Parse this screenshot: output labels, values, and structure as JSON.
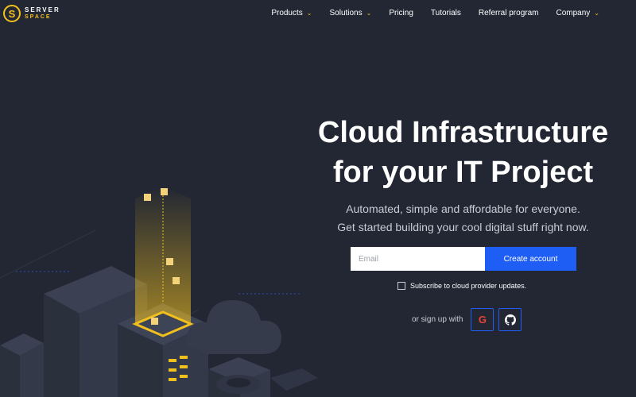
{
  "brand": {
    "word1": "SERVER",
    "word2": "SPACE",
    "mark": "S",
    "accent": "#f2c01e"
  },
  "nav": {
    "items": [
      {
        "label": "Products",
        "dropdown": true
      },
      {
        "label": "Solutions",
        "dropdown": true
      },
      {
        "label": "Pricing",
        "dropdown": false
      },
      {
        "label": "Tutorials",
        "dropdown": false
      },
      {
        "label": "Referral program",
        "dropdown": false
      },
      {
        "label": "Company",
        "dropdown": true
      }
    ]
  },
  "hero": {
    "title_line1": "Cloud Infrastructure",
    "title_line2": "for your IT Project",
    "subtitle_line1": "Automated, simple and affordable for everyone.",
    "subtitle_line2": "Get started building your cool digital stuff right now."
  },
  "signup": {
    "email_placeholder": "Email",
    "email_value": "",
    "create_label": "Create account",
    "button_color": "#1f5ef5"
  },
  "subscribe": {
    "label": "Subscribe to cloud provider updates.",
    "checked": false
  },
  "social": {
    "label": "or sign up with",
    "providers": [
      {
        "name": "google",
        "icon": "google-icon"
      },
      {
        "name": "github",
        "icon": "github-icon"
      }
    ]
  },
  "colors": {
    "background": "#222733",
    "accent": "#f2c01e",
    "primary": "#1f5ef5"
  }
}
